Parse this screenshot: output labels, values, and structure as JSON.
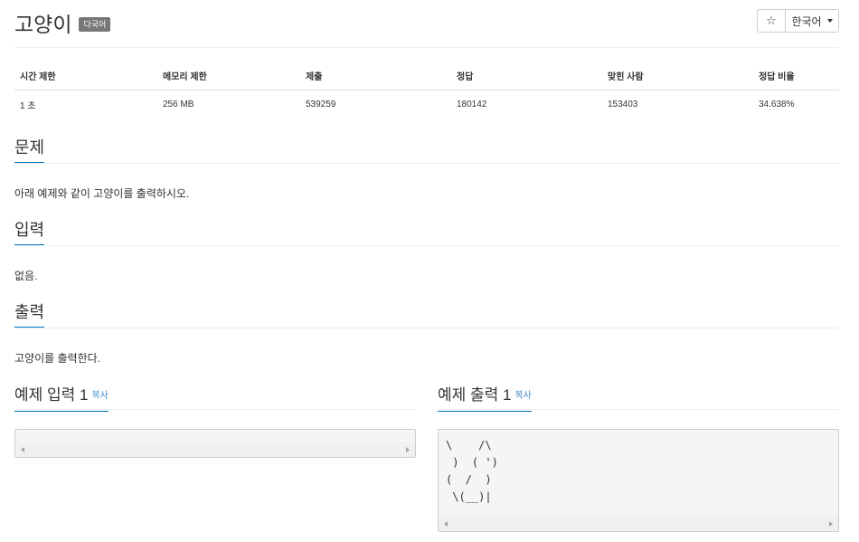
{
  "header": {
    "title": "고양이",
    "badge": "다국어",
    "star_label": "☆",
    "language": "한국어"
  },
  "info_table": {
    "columns": [
      "시간 제한",
      "메모리 제한",
      "제출",
      "정답",
      "맞힌 사람",
      "정답 비율"
    ],
    "values": [
      "1 초",
      "256 MB",
      "539259",
      "180142",
      "153403",
      "34.638%"
    ]
  },
  "problem": {
    "title": "문제",
    "body": "아래 예제와 같이 고양이를 출력하시오."
  },
  "input": {
    "title": "입력",
    "body": "없음."
  },
  "output": {
    "title": "출력",
    "body": "고양이를 출력한다."
  },
  "sample_input": {
    "title": "예제 입력 1",
    "copy_label": "복사",
    "content": ""
  },
  "sample_output": {
    "title": "예제 출력 1",
    "copy_label": "복사",
    "content": "\\    /\\\n )  ( ')\n(  /  )\n \\(__)|"
  },
  "colors": {
    "accent": "#0076c0",
    "link": "#428bca",
    "badge_bg": "#777777"
  }
}
